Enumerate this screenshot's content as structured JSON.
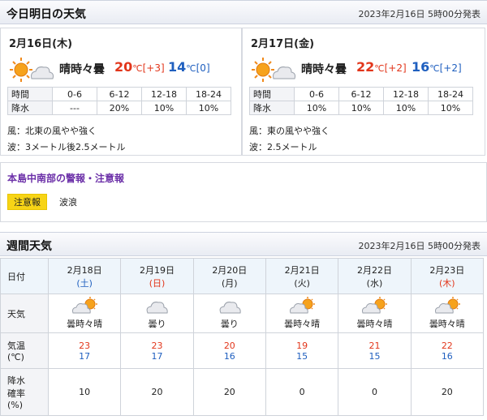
{
  "today_section": {
    "title": "今日明日の天気",
    "issued": "2023年2月16日 5時00分発表"
  },
  "days": [
    {
      "date": "2月16日(木)",
      "weather": "晴時々曇",
      "high": "20",
      "high_diff": "[+3]",
      "low": "14",
      "low_diff": "[0]",
      "unit": "℃",
      "pop_label_time": "時間",
      "pop_label_rain": "降水",
      "pop_times": [
        "0-6",
        "6-12",
        "12-18",
        "18-24"
      ],
      "pop_values": [
        "---",
        "20%",
        "10%",
        "10%"
      ],
      "wind": "風：北東の風やや強く",
      "wave": "波：3メートル後2.5メートル",
      "icon": "sun-cloud-icon"
    },
    {
      "date": "2月17日(金)",
      "weather": "晴時々曇",
      "high": "22",
      "high_diff": "[+2]",
      "low": "16",
      "low_diff": "[+2]",
      "unit": "℃",
      "pop_label_time": "時間",
      "pop_label_rain": "降水",
      "pop_times": [
        "0-6",
        "6-12",
        "12-18",
        "18-24"
      ],
      "pop_values": [
        "10%",
        "10%",
        "10%",
        "10%"
      ],
      "wind": "風：東の風やや強く",
      "wave": "波：2.5メートル",
      "icon": "sun-cloud-icon"
    }
  ],
  "warning": {
    "title": "本島中南部の警報・注意報",
    "badge": "注意報",
    "value": "波浪"
  },
  "weekly_section": {
    "title": "週間天気",
    "issued": "2023年2月16日 5時00分発表"
  },
  "weekly": {
    "row_labels": {
      "date": "日付",
      "weather": "天気",
      "temp_line1": "気温",
      "temp_line2": "(℃)",
      "rain_line1": "降水",
      "rain_line2": "確率",
      "rain_line3": "(%)"
    },
    "days": [
      {
        "date": "2月18日",
        "dow": "(土)",
        "dow_type": "sat",
        "weather": "曇時々晴",
        "icon": "cloud-sun-icon",
        "high": "23",
        "low": "17",
        "pop": "10"
      },
      {
        "date": "2月19日",
        "dow": "(日)",
        "dow_type": "sun",
        "weather": "曇り",
        "icon": "cloud-icon",
        "high": "23",
        "low": "17",
        "pop": "20"
      },
      {
        "date": "2月20日",
        "dow": "(月)",
        "dow_type": "weekday",
        "weather": "曇り",
        "icon": "cloud-icon",
        "high": "20",
        "low": "16",
        "pop": "20"
      },
      {
        "date": "2月21日",
        "dow": "(火)",
        "dow_type": "weekday",
        "weather": "曇時々晴",
        "icon": "cloud-sun-icon",
        "high": "19",
        "low": "15",
        "pop": "0"
      },
      {
        "date": "2月22日",
        "dow": "(水)",
        "dow_type": "weekday",
        "weather": "曇時々晴",
        "icon": "cloud-sun-icon",
        "high": "21",
        "low": "15",
        "pop": "0"
      },
      {
        "date": "2月23日",
        "dow": "(木)",
        "dow_type": "holiday",
        "weather": "曇時々晴",
        "icon": "cloud-sun-icon",
        "high": "22",
        "low": "16",
        "pop": "20"
      }
    ]
  },
  "colors": {
    "high": "#e2361b",
    "low": "#1f5fbf",
    "warning_title": "#6b2fa8",
    "badge": "#f7d416"
  }
}
